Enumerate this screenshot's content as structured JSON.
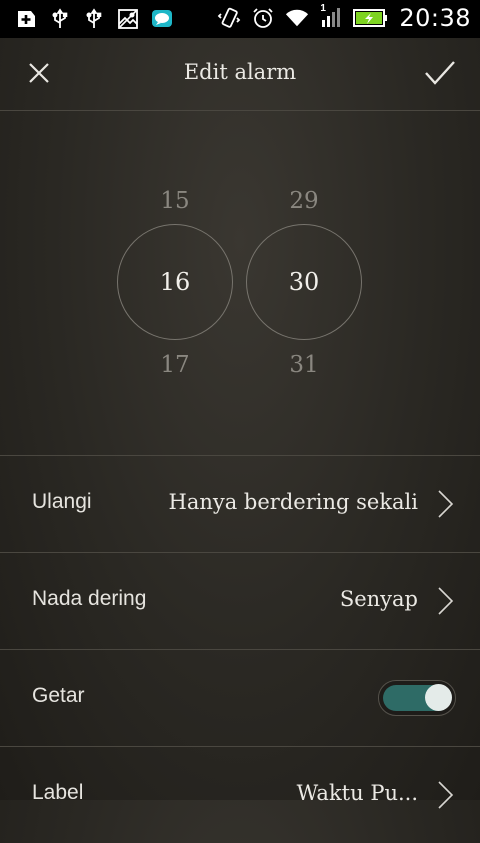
{
  "status_bar": {
    "time": "20:38",
    "left_icons": [
      "add-notification-icon",
      "usb-icon",
      "usb-icon",
      "image-icon",
      "chat-bubble-icon"
    ],
    "right_icons": [
      "vibrate-icon",
      "alarm-clock-icon",
      "wifi-icon",
      "signal-icon",
      "battery-charging-icon"
    ],
    "signal_label": "1",
    "colors": {
      "chat": "#1eb7c8",
      "battery_fill": "#7ed321"
    }
  },
  "top_bar": {
    "title": "Edit alarm",
    "close_icon": "close-icon",
    "confirm_icon": "check-icon"
  },
  "time_picker": {
    "hour": {
      "prev": "15",
      "selected": "16",
      "next": "17"
    },
    "minute": {
      "prev": "29",
      "selected": "30",
      "next": "31"
    }
  },
  "settings": [
    {
      "label": "Ulangi",
      "value": "Hanya berdering sekali",
      "type": "chevron"
    },
    {
      "label": "Nada dering",
      "value": "Senyap",
      "type": "chevron"
    },
    {
      "label": "Getar",
      "type": "toggle",
      "on": true
    },
    {
      "label": "Label",
      "value": "Waktu Pu...",
      "type": "chevron"
    }
  ],
  "colors": {
    "toggle_on": "#2e6b66",
    "divider": "#4a4740"
  }
}
